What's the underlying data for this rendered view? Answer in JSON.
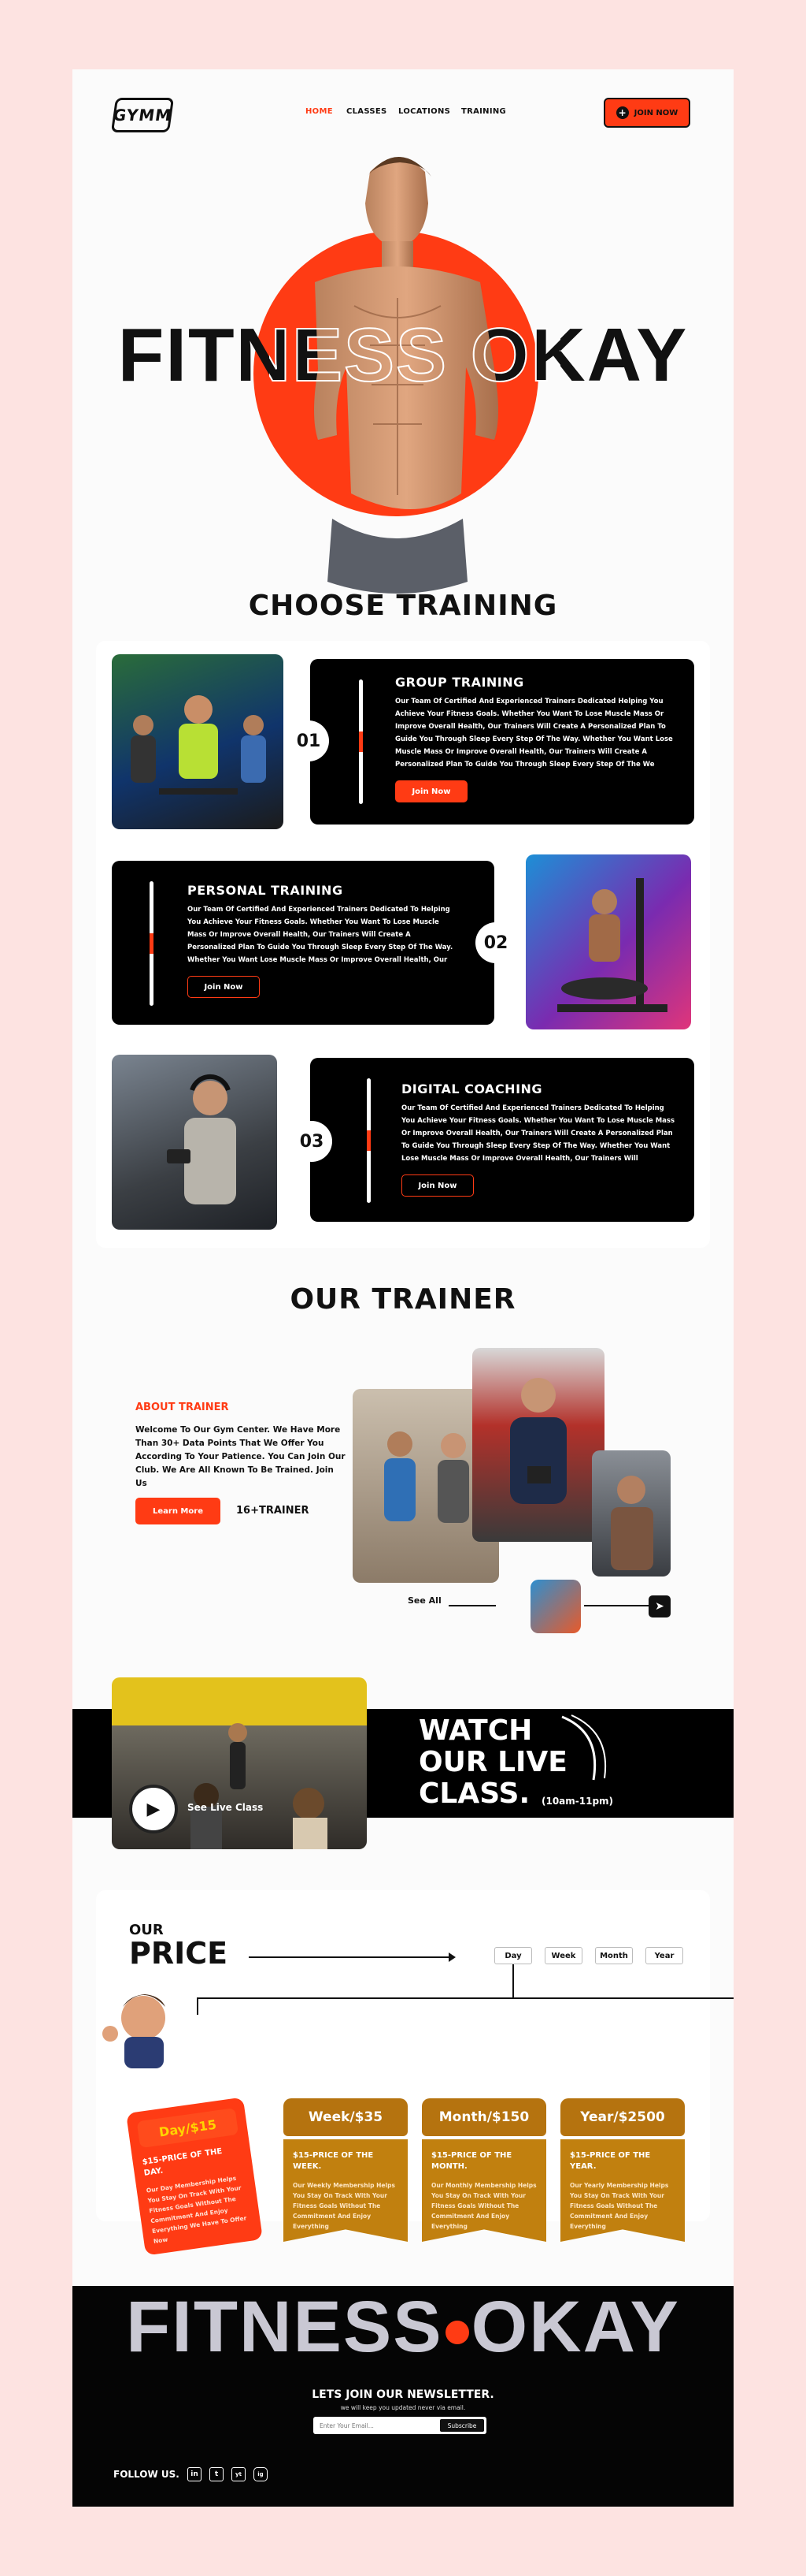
{
  "brand": {
    "logo_text": "GYMM"
  },
  "nav": {
    "items": [
      "HOME",
      "CLASSES",
      "LOCATIONS",
      "TRAINING"
    ],
    "join_button": "JOIN NOW"
  },
  "hero": {
    "title": "FITNESS OKAY"
  },
  "training": {
    "heading": "CHOOSE TRAINING",
    "cards": [
      {
        "number": "01",
        "title": "GROUP TRAINING",
        "text": "Our Team Of Certified And Experienced Trainers Dedicated  Helping You Achieve Your Fitness Goals. Whether You Want To Lose Muscle Mass Or Improve Overall Health, Our Trainers Will Create A Personalized Plan To Guide You Through Sleep Every Step Of The Way.  Whether You Want Lose Muscle Mass Or Improve Overall Health, Our Trainers Will Create A Personalized Plan To Guide You Through Sleep Every Step Of The We",
        "button": "Join Now"
      },
      {
        "number": "02",
        "title": "PERSONAL TRAINING",
        "text": "Our Team Of Certified And Experienced Trainers Dedicated To Helping You Achieve Your Fitness Goals. Whether You Want To Lose Muscle Mass Or Improve Overall Health, Our Trainers Will Create A Personalized Plan To Guide You Through Sleep Every Step Of The Way.  Whether You Want Lose Muscle Mass Or Improve Overall Health, Our Trainers Will",
        "button": "Join Now"
      },
      {
        "number": "03",
        "title": "DIGITAL COACHING",
        "text": "Our Team Of Certified And Experienced Trainers Dedicated To Helping You Achieve Your Fitness Goals. Whether You Want To Lose Muscle Mass Or Improve Overall Health, Our Trainers Will Create A Personalized Plan To Guide You Through Sleep Every Step Of The Way.  Whether You Want Lose Muscle Mass Or Improve Overall Health, Our Trainers Will",
        "button": "Join Now"
      }
    ]
  },
  "trainer": {
    "heading": "OUR TRAINER",
    "about_label": "ABOUT TRAINER",
    "about_text": "Welcome To Our Gym Center. We Have More Than 30+ Data Points That We Offer You According To Your Patience. You Can Join Our Club. We Are All Known To Be Trained. Join Us",
    "learn_button": "Learn More",
    "count": "16+TRAINER",
    "see_all": "See All"
  },
  "live": {
    "title_lines": [
      "WATCH",
      "OUR LIVE",
      "CLASS."
    ],
    "time": "(10am-11pm)",
    "video_label": "See Live Class"
  },
  "price": {
    "heading_small": "OUR",
    "heading_big": "PRICE",
    "tabs": [
      "Day",
      "Week",
      "Month",
      "Year"
    ],
    "cards": [
      {
        "title": "Day/$15",
        "subtitle": "$15-PRICE OF THE DAY.",
        "text": "Our Day Membership Helps You Stay On Track With Your Fitness Goals  Without The Commitment And Enjoy Everything We Have To Offer Now"
      },
      {
        "title": "Week/$35",
        "subtitle": "$15-PRICE OF THE WEEK.",
        "text": "Our Weekly Membership Helps You Stay On Track With Your Fitness Goals  Without The Commitment  And Enjoy Everything"
      },
      {
        "title": "Month/$150",
        "subtitle": "$15-PRICE OF THE MONTH.",
        "text": "Our Monthly Membership Helps You Stay On Track With Your Fitness Goals  Without The Commitment  And Enjoy Everything"
      },
      {
        "title": "Year/$2500",
        "subtitle": "$15-PRICE OF THE YEAR.",
        "text": "Our Yearly Membership Helps You Stay On Track With Your Fitness Goals  Without The Commitment And Enjoy Everything"
      }
    ]
  },
  "footer": {
    "title_left": "FITNESS",
    "title_right": "OKAY",
    "newsletter_title": "LETS JOIN OUR NEWSLETTER.",
    "newsletter_sub": "we will keep you updated never via email.",
    "email_placeholder": "Enter Your Email...",
    "subscribe": "Subscribe",
    "follow": "FOLLOW US.",
    "social": [
      "in",
      "t",
      "yt",
      "ig"
    ]
  },
  "colors": {
    "accent": "#ff3b14",
    "gold": "#c1800f",
    "dark": "#000000",
    "bg": "#fde3e1"
  }
}
